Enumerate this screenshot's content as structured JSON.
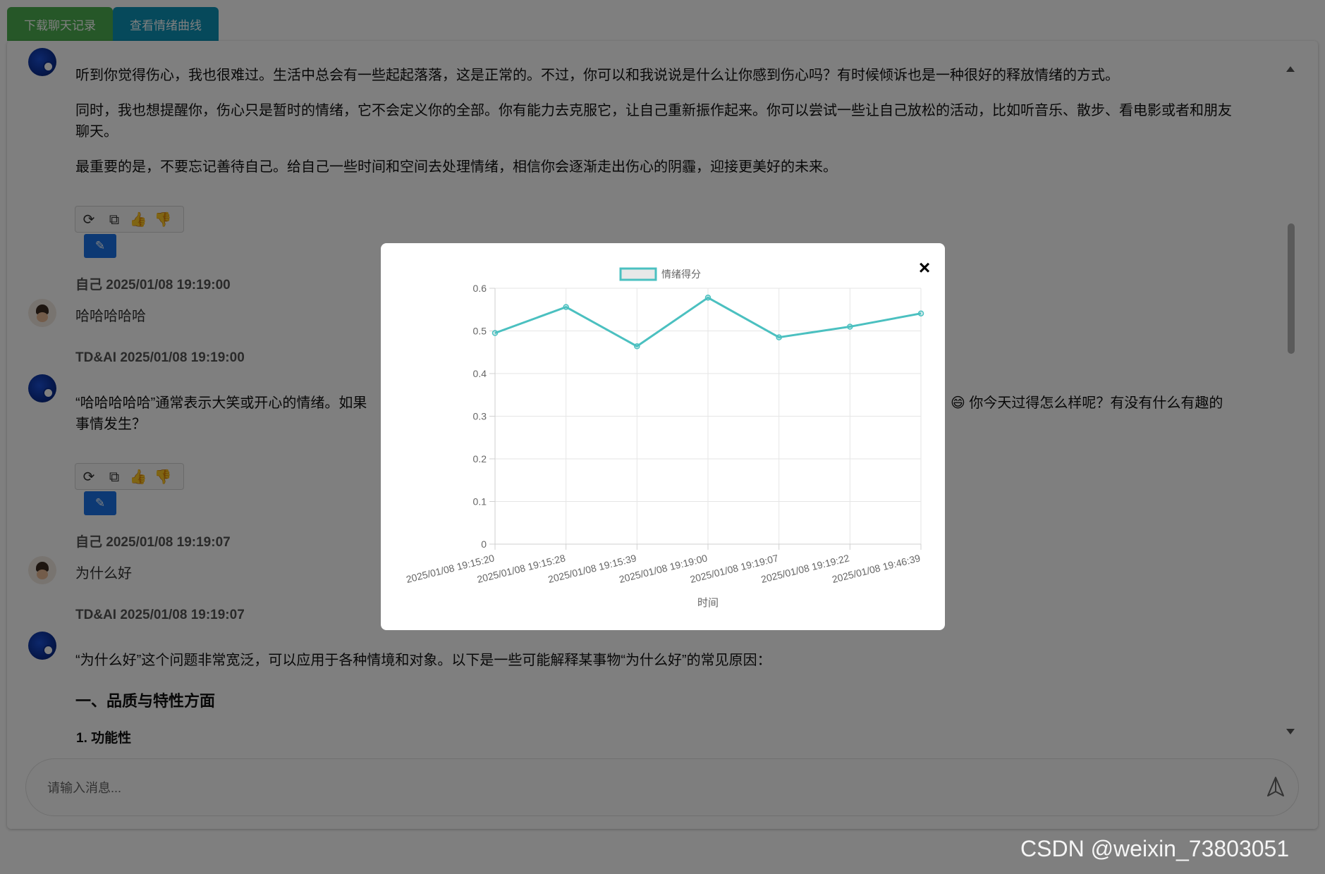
{
  "topbar": {
    "download_label": "下载聊天记录",
    "curve_label": "查看情绪曲线"
  },
  "messages": {
    "ai_1": {
      "p1": "听到你觉得伤心，我也很难过。生活中总会有一些起起落落，这是正常的。不过，你可以和我说说是什么让你感到伤心吗？有时候倾诉也是一种很好的释放情绪的方式。",
      "p2a": "同时，我也想提醒你，伤心只是暂时的情绪，它不会定义你的全部。你有能力去克服它，让自己重新振作起来。你可以尝试一些让自己放松的活动，比如听音乐、散步、看电影或者和朋友",
      "p2b": "聊天。",
      "p3": "最重要的是，不要忘记善待自己。给自己一些时间和空间去处理情绪，相信你会逐渐走出伤心的阴霾，迎接更美好的未来。"
    },
    "user_1": {
      "meta": "自己  2025/01/08 19:19:00",
      "text": "哈哈哈哈哈"
    },
    "ai_2": {
      "meta": "TD&AI  2025/01/08 19:19:00",
      "line1_left": "“哈哈哈哈哈”通常表示大笑或开心的情绪。如果",
      "line1_right": "😄 你今天过得怎么样呢？有没有什么有趣的",
      "line2": "事情发生？"
    },
    "user_2": {
      "meta": "自己  2025/01/08 19:19:07",
      "text": "为什么好"
    },
    "ai_3": {
      "meta": "TD&AI  2025/01/08 19:19:07",
      "p1": "“为什么好”这个问题非常宽泛，可以应用于各种情境和对象。以下是一些可能解释某事物“为什么好”的常见原因：",
      "heading": "一、品质与特性方面",
      "sub": "1. 功能性"
    }
  },
  "input": {
    "placeholder": "请输入消息..."
  },
  "modal": {
    "close_label": "×"
  },
  "chart_data": {
    "type": "line",
    "title": "",
    "xlabel": "时间",
    "ylabel": "",
    "ylim": [
      0,
      0.6
    ],
    "yticks": [
      0,
      0.1,
      0.2,
      0.3,
      0.4,
      0.5,
      0.6
    ],
    "grid": true,
    "legend": "top-center",
    "categories": [
      "2025/01/08 19:15:20",
      "2025/01/08 19:15:28",
      "2025/01/08 19:15:39",
      "2025/01/08 19:19:00",
      "2025/01/08 19:19:07",
      "2025/01/08 19:19:22",
      "2025/01/08 19:46:39"
    ],
    "series": [
      {
        "name": "情绪得分",
        "values": [
          0.495,
          0.556,
          0.464,
          0.578,
          0.485,
          0.51,
          0.541
        ],
        "color": "#4bc0c0"
      }
    ]
  },
  "watermark": "CSDN @weixin_73803051",
  "colors": {
    "download_btn": "#4caf50",
    "curve_btn": "#0c93b7",
    "edit_btn": "#1a73e8",
    "line": "#4bc0c0"
  }
}
